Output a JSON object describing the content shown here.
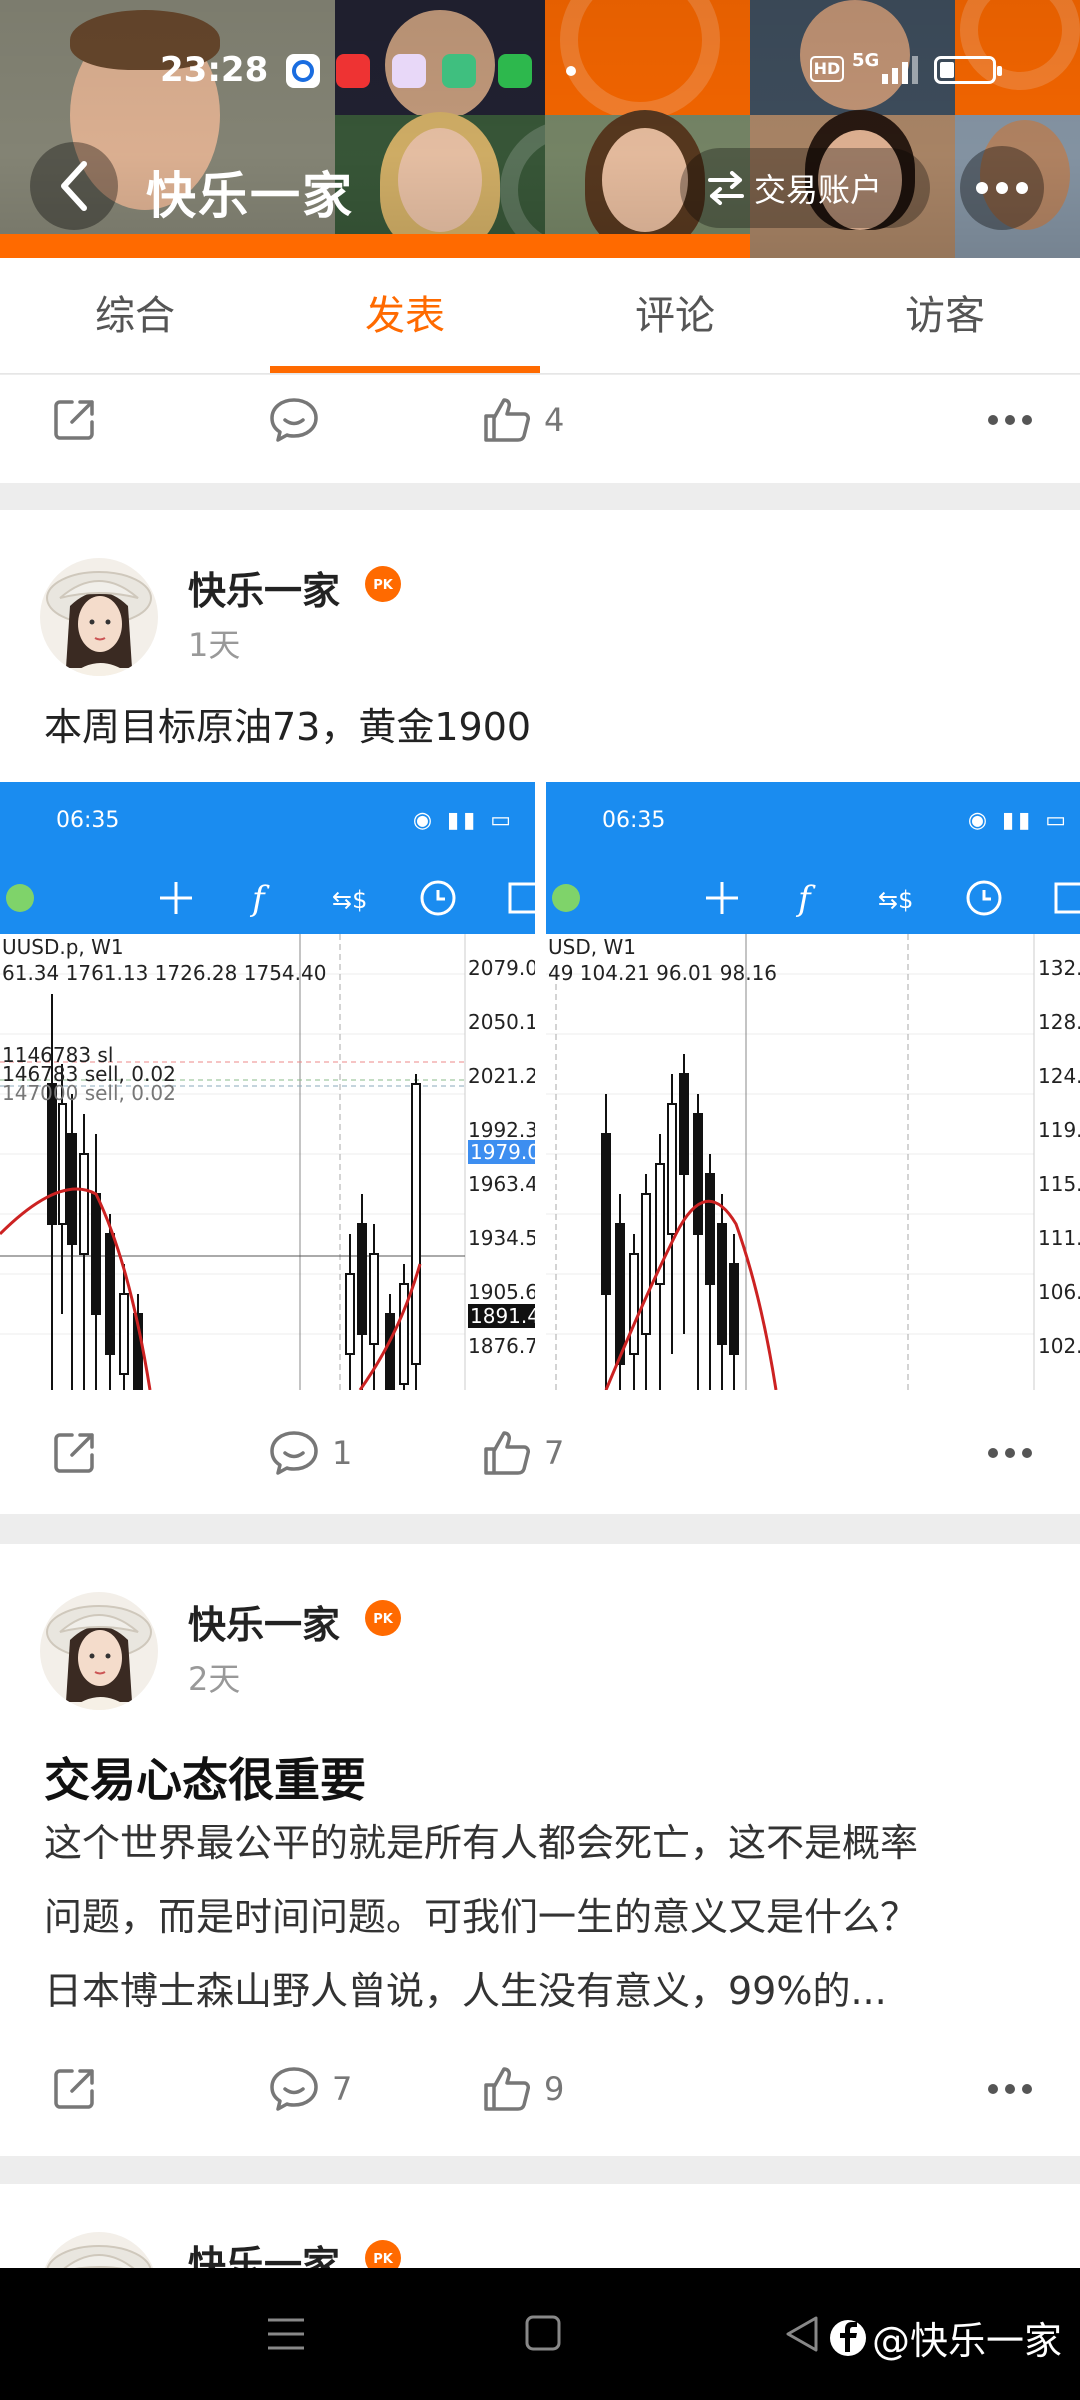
{
  "status_bar": {
    "time": "23:28",
    "network": "5G",
    "hd": "HD"
  },
  "header": {
    "title": "快乐一家",
    "account_label": "交易账户"
  },
  "tabs": [
    {
      "label": "综合",
      "active": false
    },
    {
      "label": "发表",
      "active": true
    },
    {
      "label": "评论",
      "active": false
    },
    {
      "label": "访客",
      "active": false
    }
  ],
  "top_actions": {
    "likes": "4"
  },
  "posts": [
    {
      "user": "快乐一家",
      "badge": "PK",
      "time": "1天",
      "text": "本周目标原油73，黄金1900",
      "comments": "1",
      "likes": "7",
      "images": [
        {
          "time": "06:35",
          "symbol": "UUSD.p, W1",
          "ohlc": "61.34 1761.13 1726.28 1754.40",
          "levels": [
            "2079.0",
            "2050.1",
            "2021.2",
            "1992.3",
            "1979.0",
            "1963.4",
            "1934.5",
            "1905.6",
            "1891.4",
            "1876.7"
          ],
          "orders": [
            "1146783 sl",
            "146783 sell, 0.02",
            "147000 sell, 0.02"
          ]
        },
        {
          "time": "06:35",
          "symbol": "USD, W1",
          "ohlc": "49 104.21 96.01 98.16",
          "levels": [
            "132.",
            "128.",
            "124.",
            "119.",
            "115.",
            "111.",
            "106.",
            "102."
          ]
        }
      ]
    },
    {
      "user": "快乐一家",
      "badge": "PK",
      "time": "2天",
      "title": "交易心态很重要",
      "lines": [
        "这个世界最公平的就是所有人都会死亡，这不是概率",
        "问题，而是时间问题。可我们一生的意义又是什么？",
        "日本博士森山野人曾说，人生没有意义，99%的..."
      ],
      "comments": "7",
      "likes": "9"
    },
    {
      "user": "快乐一家",
      "badge": "PK"
    }
  ],
  "watermark": "@快乐一家",
  "colors": {
    "accent": "#ff6a00",
    "chart_blue": "#1a8cf0"
  }
}
